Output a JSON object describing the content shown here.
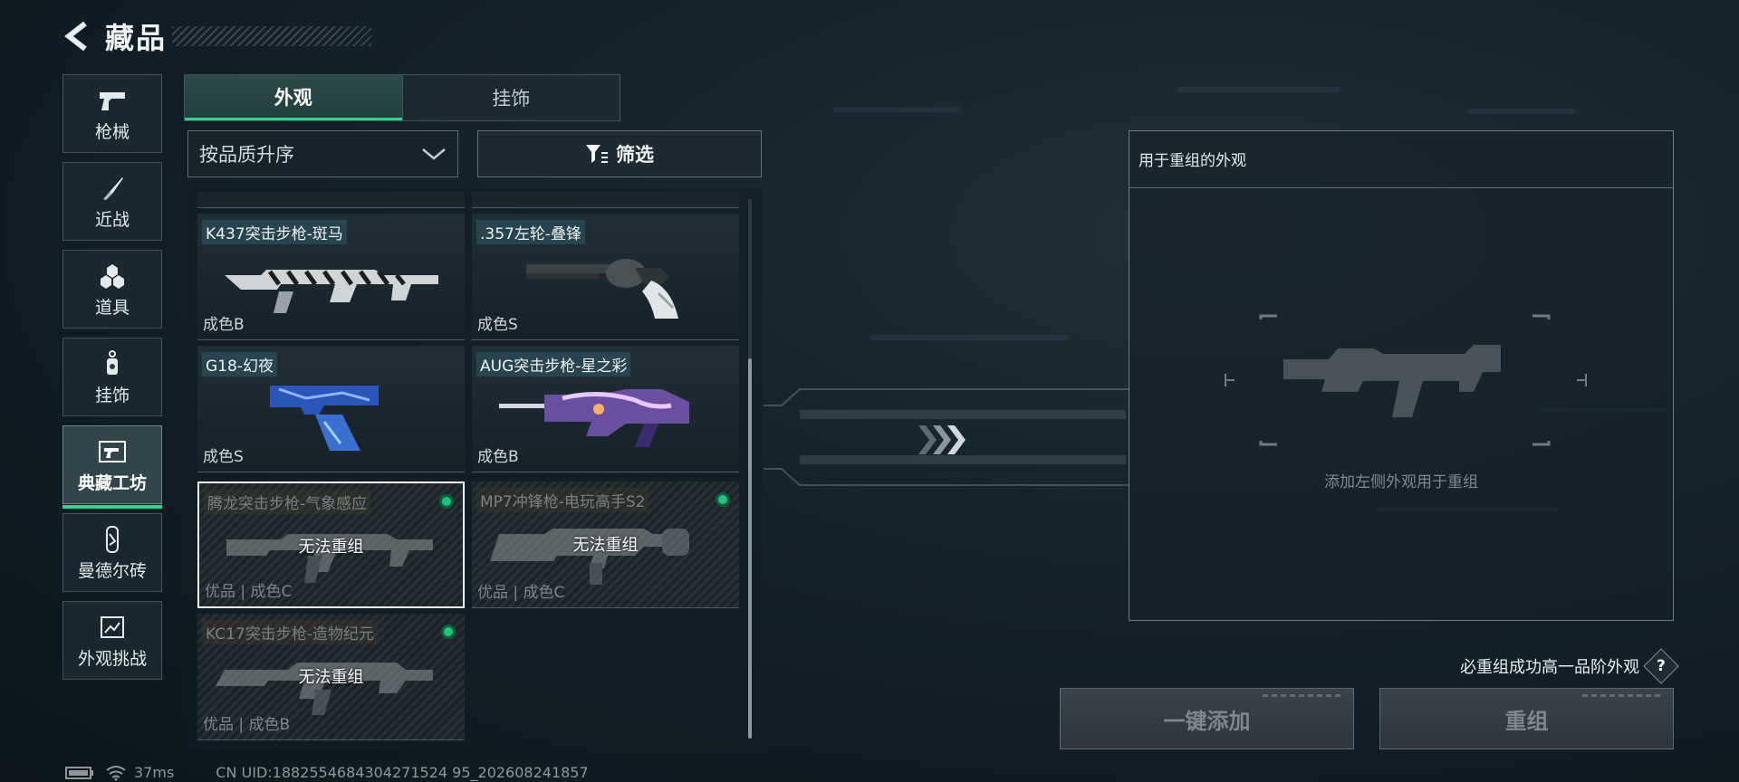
{
  "header": {
    "title": "藏品"
  },
  "sidebar": {
    "items": [
      {
        "label": "枪械",
        "icon": "pistol-icon",
        "active": false
      },
      {
        "label": "近战",
        "icon": "knife-icon",
        "active": false
      },
      {
        "label": "道具",
        "icon": "gear-cluster-icon",
        "active": false
      },
      {
        "label": "挂饰",
        "icon": "charm-icon",
        "active": false
      },
      {
        "label": "典藏工坊",
        "icon": "workshop-icon",
        "active": true
      },
      {
        "label": "曼德尔砖",
        "icon": "brick-icon",
        "active": false
      },
      {
        "label": "外观挑战",
        "icon": "challenge-icon",
        "active": false
      }
    ]
  },
  "tabs": [
    {
      "label": "外观",
      "active": true
    },
    {
      "label": "挂饰",
      "active": false
    }
  ],
  "sort": {
    "value": "按品质升序"
  },
  "filter": {
    "label": "筛选"
  },
  "cards": [
    {
      "name": "K437突击步枪-斑马",
      "grade": "成色B",
      "locked": false
    },
    {
      "name": ".357左轮-叠锋",
      "grade": "成色S",
      "locked": false
    },
    {
      "name": "G18-幻夜",
      "grade": "成色S",
      "locked": false
    },
    {
      "name": "AUG突击步枪-星之彩",
      "grade": "成色B",
      "locked": false
    },
    {
      "name": "腾龙突击步枪-气象感应",
      "grade": "优品 | 成色C",
      "locked": true,
      "lock_text": "无法重组",
      "selected": true
    },
    {
      "name": "MP7冲锋枪-电玩高手S2",
      "grade": "优品 | 成色C",
      "locked": true,
      "lock_text": "无法重组"
    },
    {
      "name": "KC17突击步枪-造物纪元",
      "grade": "优品 | 成色B",
      "locked": true,
      "lock_text": "无法重组"
    }
  ],
  "panel": {
    "title": "用于重组的外观",
    "empty_hint": "添加左侧外观用于重组"
  },
  "guarantee": {
    "text": "必重组成功高一品阶外观",
    "help": "?"
  },
  "buttons": {
    "add_all": "一键添加",
    "reassemble": "重组"
  },
  "status": {
    "ping": "37ms",
    "uid": "CN UID:1882554684304271524 95_202608241857"
  },
  "colors": {
    "accent": "#2fd38f",
    "background": "#14222a"
  }
}
